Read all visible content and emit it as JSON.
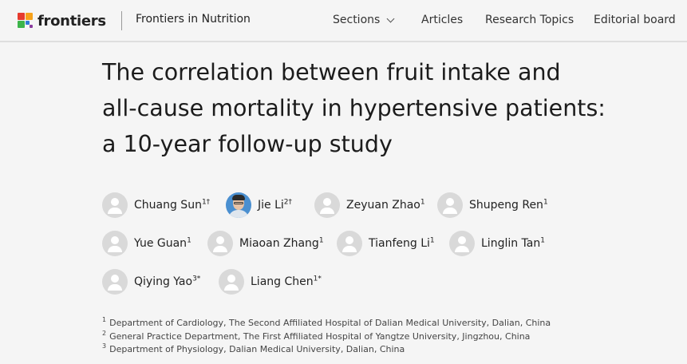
{
  "header": {
    "logo_text": "frontiers",
    "journal_name": "Frontiers in Nutrition",
    "nav": {
      "sections": "Sections",
      "articles": "Articles",
      "research_topics": "Research Topics",
      "editorial_board": "Editorial board"
    }
  },
  "article": {
    "title_lines": [
      "The correlation between fruit intake and",
      "all-cause mortality in hypertensive patients:",
      "a 10-year follow-up study"
    ],
    "authors": [
      {
        "name": "Chuang Sun",
        "sup": "1†",
        "photo": false
      },
      {
        "name": "Jie Li",
        "sup": "2†",
        "photo": true
      },
      {
        "name": "Zeyuan Zhao",
        "sup": "1",
        "photo": false
      },
      {
        "name": "Shupeng Ren",
        "sup": "1",
        "photo": false
      },
      {
        "name": "Yue Guan",
        "sup": "1",
        "photo": false
      },
      {
        "name": "Miaoan Zhang",
        "sup": "1",
        "photo": false
      },
      {
        "name": "Tianfeng Li",
        "sup": "1",
        "photo": false
      },
      {
        "name": "Linglin Tan",
        "sup": "1",
        "photo": false
      },
      {
        "name": "Qiying Yao",
        "sup": "3*",
        "photo": false
      },
      {
        "name": "Liang Chen",
        "sup": "1*",
        "photo": false
      }
    ],
    "affiliations": [
      {
        "num": "1",
        "text": "Department of Cardiology, The Second Affiliated Hospital of Dalian Medical University, Dalian, China"
      },
      {
        "num": "2",
        "text": "General Practice Department, The First Affiliated Hospital of Yangtze University, Jingzhou, China"
      },
      {
        "num": "3",
        "text": "Department of Physiology, Dalian Medical University, Dalian, China"
      }
    ]
  },
  "colors": {
    "background": "#f5f5f5",
    "logo_squares": [
      "#e63b2e",
      "#f7a21b",
      "#3cb54a",
      "#2e7bd6",
      "#8b3c9e"
    ]
  }
}
